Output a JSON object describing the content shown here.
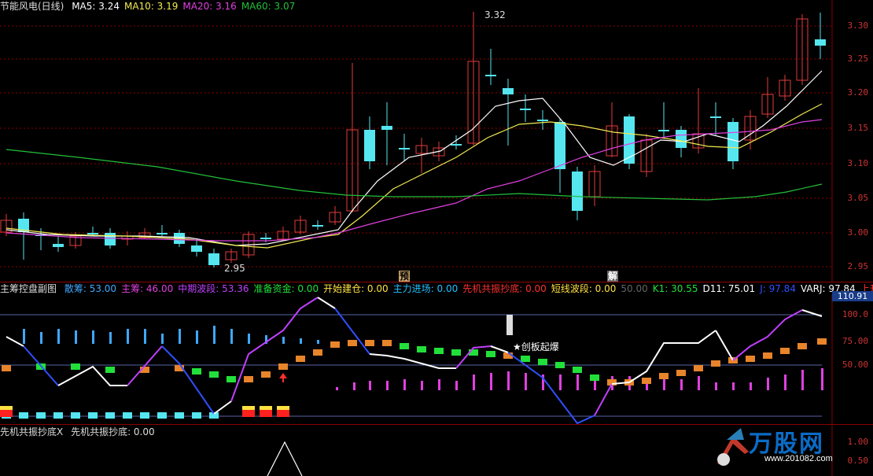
{
  "colors": {
    "up": "#e23b3b",
    "down": "#55e6f0",
    "ma5": "#ffffff",
    "ma10": "#f2ea52",
    "ma20": "#e040e0",
    "ma60": "#22c03a",
    "grid": "#8b0000",
    "axis": "#cc3333"
  },
  "main": {
    "title": "节能风电(日线)",
    "mas": [
      {
        "label": "MA5: 3.24",
        "color": "#ffffff"
      },
      {
        "label": "MA10: 3.19",
        "color": "#f2ea52"
      },
      {
        "label": "MA20: 3.16",
        "color": "#e040e0"
      },
      {
        "label": "MA60: 3.07",
        "color": "#22c03a"
      }
    ],
    "ticks": [
      "3.30",
      "3.25",
      "3.20",
      "3.15",
      "3.10",
      "3.05",
      "3.00",
      "2.95"
    ],
    "high_label": "3.32",
    "low_label": "2.95",
    "signal_yu": "预",
    "signal_jie": "解"
  },
  "sub": {
    "title": "主筹控盘副图",
    "stats": [
      {
        "label": "散筹: 53.00",
        "color": "#3fa8ff"
      },
      {
        "label": "主筹: 46.00",
        "color": "#e040e0"
      },
      {
        "label": "中期波段: 53.36",
        "color": "#c040ff"
      },
      {
        "label": "准备资金: 0.00",
        "color": "#22e03a"
      },
      {
        "label": "开始建仓: 0.00",
        "color": "#ffe040"
      },
      {
        "label": "主力进场: 0.00",
        "color": "#22c0ff"
      },
      {
        "label": "先机共振抄底: 0.00",
        "color": "#ff3030"
      },
      {
        "label": "短线波段: 0.00",
        "color": "#ffe040"
      },
      {
        "label": "50.00",
        "color": "#666666"
      },
      {
        "label": "K1: 30.55",
        "color": "#22e03a"
      },
      {
        "label": "D11: 75.01",
        "color": "#ffffff"
      },
      {
        "label": "J: 97.84",
        "color": "#3050ff"
      },
      {
        "label": "VARJ: 97.84",
        "color": "#ffffff"
      },
      {
        "label": "上升",
        "color": "#ff3030"
      }
    ],
    "ticks": [
      "100.0",
      "75.00",
      "50.00"
    ],
    "current_value": "110.91",
    "annotation": "★创板起爆"
  },
  "third": {
    "title": "先机共振抄底X",
    "stat": "先机共振抄底: 0.00",
    "ticks": [
      "1.00",
      "0.50"
    ]
  },
  "watermark": {
    "text": "万股网",
    "url": "www.201082.com"
  }
}
